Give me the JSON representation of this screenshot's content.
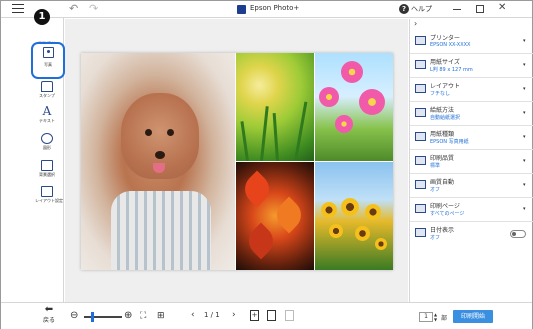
{
  "window": {
    "title": "Epson Photo+",
    "help_label": "ヘルプ"
  },
  "left_toolbar": {
    "top_label": "背景/素材",
    "callout_number": "1",
    "tools": [
      {
        "name": "photo",
        "label": "写真",
        "icon": "photo-add-icon",
        "selected": true
      },
      {
        "name": "stamp",
        "label": "スタンプ",
        "icon": "stamp-icon"
      },
      {
        "name": "text",
        "label": "テキスト",
        "icon": "text-icon",
        "glyph": "A"
      },
      {
        "name": "shape",
        "label": "図形",
        "icon": "shape-icon"
      },
      {
        "name": "background",
        "label": "背景選択",
        "icon": "background-icon"
      },
      {
        "name": "layout-settings",
        "label": "レイアウト設定",
        "icon": "layout-settings-icon"
      }
    ]
  },
  "settings": [
    {
      "name": "プリンター",
      "value": "EPSON XX-XXXX",
      "icon": "printer-icon"
    },
    {
      "name": "用紙サイズ",
      "value": "L判 89 x 127 mm",
      "icon": "paper-size-icon"
    },
    {
      "name": "レイアウト",
      "value": "フチなし",
      "icon": "layout-icon"
    },
    {
      "name": "給紙方法",
      "value": "自動給紙選択",
      "icon": "paper-feed-icon"
    },
    {
      "name": "用紙種類",
      "value": "EPSON 写真用紙",
      "icon": "paper-type-icon"
    },
    {
      "name": "印刷品質",
      "value": "標準",
      "icon": "print-quality-icon"
    },
    {
      "name": "画質自動",
      "value": "オフ",
      "icon": "auto-quality-icon"
    },
    {
      "name": "印刷ページ",
      "value": "すべてのページ",
      "icon": "print-pages-icon"
    },
    {
      "name": "日付表示",
      "value": "オフ",
      "icon": "date-icon",
      "toggle": true,
      "toggle_on": false
    }
  ],
  "bottom_bar": {
    "back_label": "戻る",
    "page_indicator": "1 / 1",
    "copies": "1",
    "copies_unit": "部",
    "print_label": "印刷開始",
    "zoom_level": 0.2
  },
  "colors": {
    "accent": "#1e6fd9",
    "print_button": "#3b8fe0",
    "selected_ring": "#1e6fd9"
  }
}
